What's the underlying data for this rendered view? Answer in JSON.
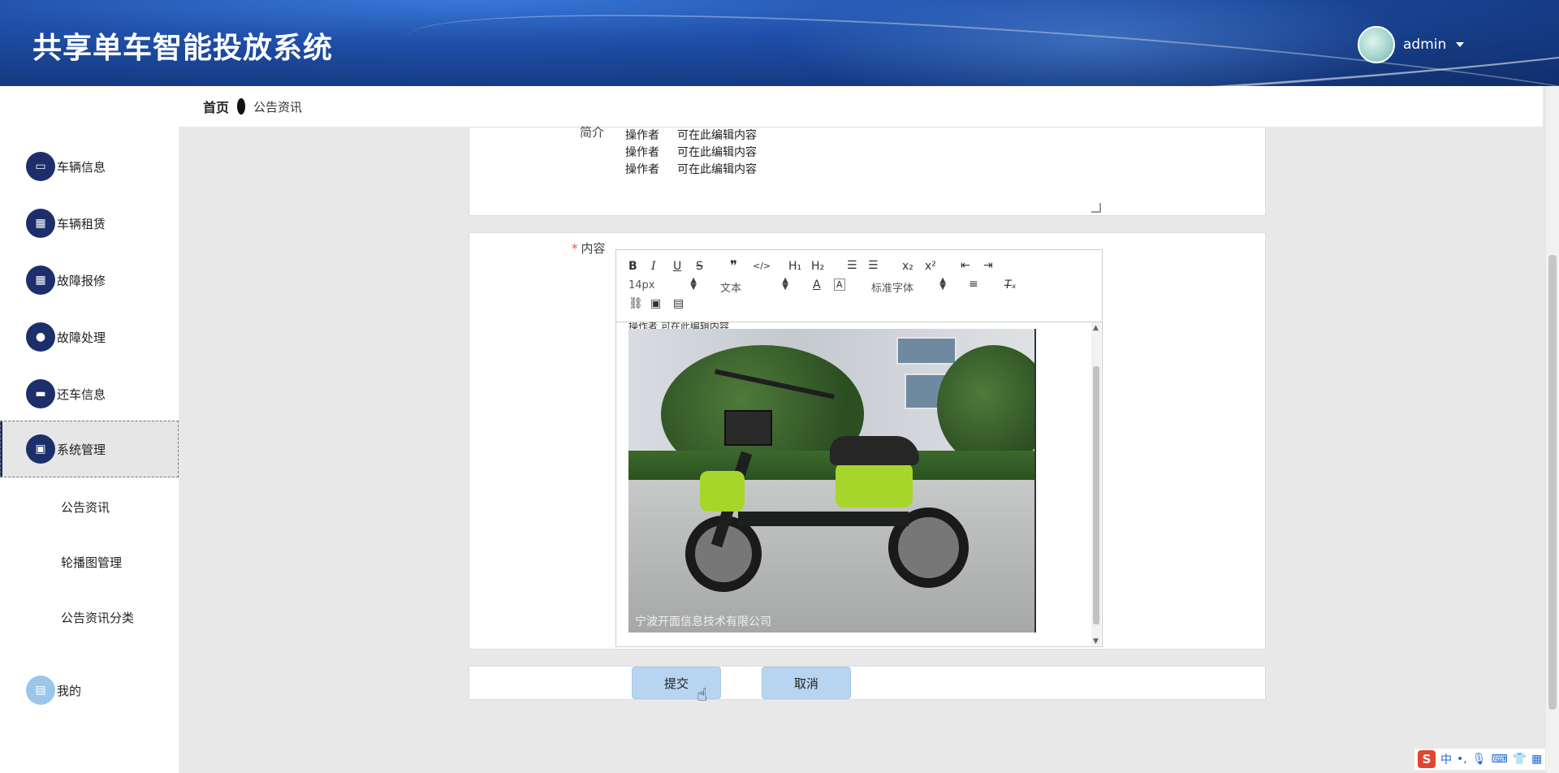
{
  "app": {
    "title": "共享单车智能投放系统",
    "user": "admin"
  },
  "breadcrumb": {
    "home": "首页",
    "current": "公告资讯"
  },
  "sidebar": {
    "items": [
      {
        "label": "车辆信息",
        "icon": "monitor-icon"
      },
      {
        "label": "车辆租赁",
        "icon": "grid-icon"
      },
      {
        "label": "故障报修",
        "icon": "grid-icon"
      },
      {
        "label": "故障处理",
        "icon": "location-pin-icon"
      },
      {
        "label": "还车信息",
        "icon": "return-icon"
      },
      {
        "label": "系统管理",
        "icon": "clipboard-icon"
      }
    ],
    "sub_items": [
      "公告资讯",
      "轮播图管理",
      "公告资讯分类"
    ],
    "mine": {
      "label": "我的",
      "icon": "profile-icon"
    }
  },
  "form": {
    "intro_label": "简介",
    "intro_lines": [
      {
        "role": "操作者",
        "text": "可在此编辑内容"
      },
      {
        "role": "操作者",
        "text": "可在此编辑内容"
      },
      {
        "role": "操作者",
        "text": "可在此编辑内容"
      }
    ],
    "content_label": "内容",
    "content_required": "*",
    "editor": {
      "font_size": "14px",
      "paragraph": "文本",
      "font_family": "标准字体",
      "cut_line": "操作者 可在此编辑内容",
      "image_watermark": "宁波开面信息技术有限公司",
      "toolbar": {
        "bold": "B",
        "italic": "I",
        "underline": "U",
        "strike": "S",
        "quote": "❞",
        "code": "</>",
        "h1": "H₁",
        "h2": "H₂",
        "sub": "x₂",
        "sup": "x²",
        "clean": "T̶ₓ"
      }
    },
    "submit": "提交",
    "cancel": "取消"
  },
  "ime": {
    "logo": "S",
    "lang": "中",
    "punct": "•,"
  }
}
